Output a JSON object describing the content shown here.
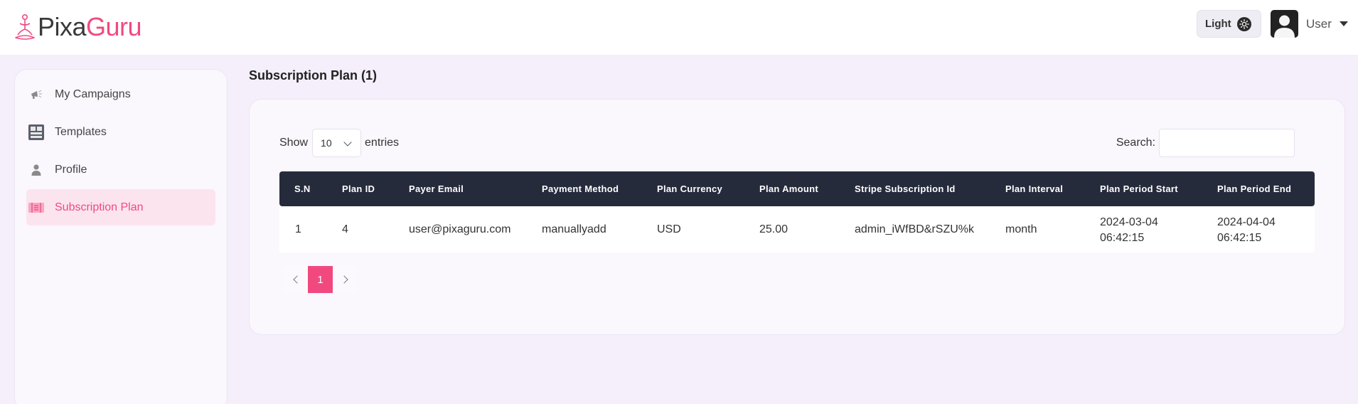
{
  "app": {
    "logo_part1": "Pixa",
    "logo_part2": "Guru"
  },
  "header": {
    "theme_label": "Light",
    "theme_icon": "sun-icon",
    "user_label": "User"
  },
  "sidebar": {
    "items": [
      {
        "label": "My Campaigns",
        "icon": "megaphone-icon",
        "active": false
      },
      {
        "label": "Templates",
        "icon": "template-icon",
        "active": false
      },
      {
        "label": "Profile",
        "icon": "person-icon",
        "active": false
      },
      {
        "label": "Subscription Plan",
        "icon": "ticket-icon",
        "active": true
      }
    ]
  },
  "main": {
    "title": "Subscription Plan (1)",
    "show_label": "Show",
    "entries_value": "10",
    "entries_label": "entries",
    "search_label": "Search:",
    "search_value": "",
    "table": {
      "headers": [
        "S.N",
        "Plan ID",
        "Payer Email",
        "Payment Method",
        "Plan Currency",
        "Plan Amount",
        "Stripe Subscription Id",
        "Plan Interval",
        "Plan Period Start",
        "Plan Period End"
      ],
      "rows": [
        [
          "1",
          "4",
          "user@pixaguru.com",
          "manuallyadd",
          "USD",
          "25.00",
          "admin_iWfBD&rSZU%k",
          "month",
          "2024-03-04 06:42:15",
          "2024-04-04 06:42:15"
        ]
      ]
    },
    "pagination": {
      "current_page": "1"
    }
  },
  "colors": {
    "accent": "#f1497f",
    "header_row": "#262b3c",
    "background": "#f4effa"
  }
}
